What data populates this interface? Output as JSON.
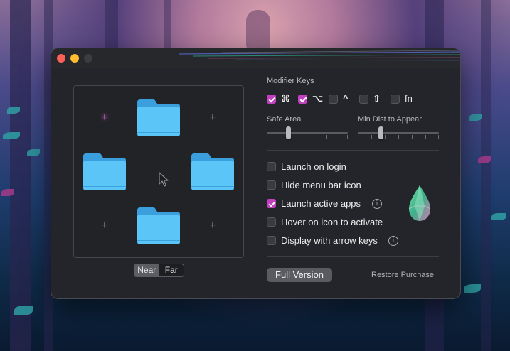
{
  "window": {
    "traffic_lights": {
      "close_color": "#fe5f57",
      "minimize_color": "#febc2e",
      "zoom_color": "#3b3c40"
    }
  },
  "preview": {
    "folder_icon": "folder-icon",
    "cursor_icon": "cursor-arrow-icon",
    "plus_glyph": "+",
    "distance_toggle": {
      "near_label": "Near",
      "far_label": "Far",
      "selected": "Near"
    }
  },
  "modifier_keys": {
    "title": "Modifier Keys",
    "keys": [
      {
        "symbol": "⌘",
        "checked": true
      },
      {
        "symbol": "⌥",
        "checked": true
      },
      {
        "symbol": "^",
        "checked": false
      },
      {
        "symbol": "⇧",
        "checked": false
      },
      {
        "symbol": "fn",
        "checked": false
      }
    ]
  },
  "sliders": {
    "safe_area": {
      "label": "Safe Area",
      "value_fraction": 0.25
    },
    "min_dist": {
      "label": "Min Dist to Appear",
      "value_fraction": 0.27
    }
  },
  "options": [
    {
      "label": "Launch on login",
      "checked": false,
      "info": false
    },
    {
      "label": "Hide menu bar icon",
      "checked": false,
      "info": false
    },
    {
      "label": "Launch active apps",
      "checked": true,
      "info": true
    },
    {
      "label": "Hover on icon to activate",
      "checked": false,
      "info": false
    },
    {
      "label": "Display with arrow keys",
      "checked": false,
      "info": true
    }
  ],
  "info_glyph": "i",
  "footer": {
    "full_version_label": "Full Version",
    "restore_label": "Restore Purchase"
  },
  "colors": {
    "accent": "#c23fc0",
    "folder_blue": "#55c3f8",
    "window_bg": "#24252a"
  }
}
